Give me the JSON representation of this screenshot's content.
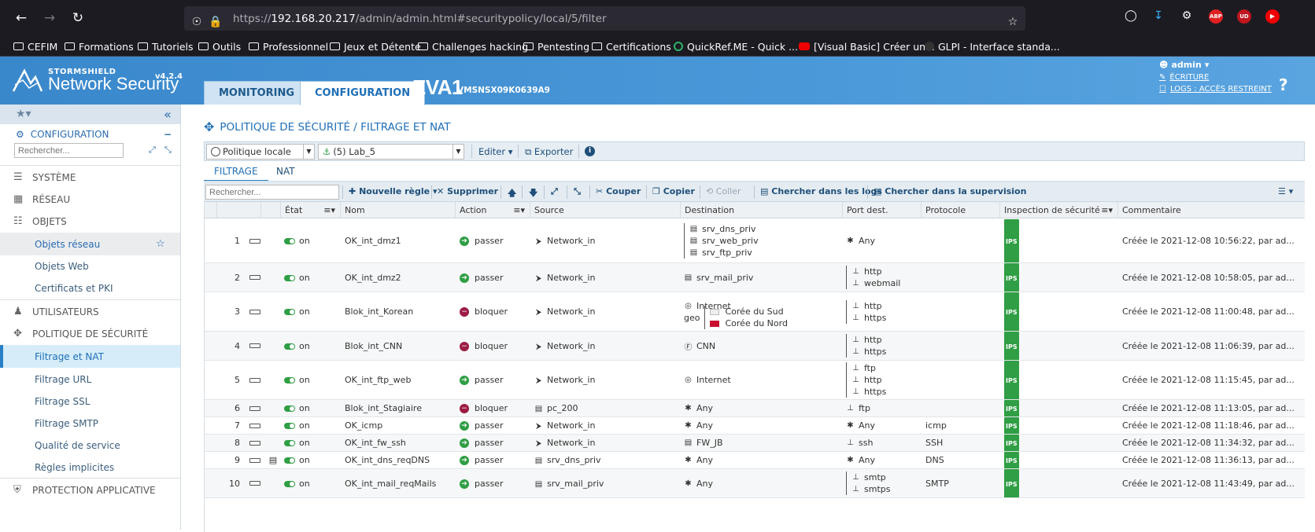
{
  "browser": {
    "url_base": "https://",
    "url_host": "192.168.20.217",
    "url_path": "/admin/admin.html#securitypolicy/local/5/filter",
    "bookmarks": [
      {
        "label": "CEFIM",
        "icon": "folder-icon"
      },
      {
        "label": "Formations",
        "icon": "folder-icon"
      },
      {
        "label": "Tutoriels",
        "icon": "folder-icon"
      },
      {
        "label": "Outils",
        "icon": "folder-icon"
      },
      {
        "label": "Professionnel",
        "icon": "folder-icon"
      },
      {
        "label": "Jeux et Détente",
        "icon": "folder-icon"
      },
      {
        "label": "Challenges hacking",
        "icon": "folder-icon"
      },
      {
        "label": "Pentesting",
        "icon": "folder-icon"
      },
      {
        "label": "Certifications",
        "icon": "folder-icon"
      },
      {
        "label": "QuickRef.ME - Quick ...",
        "icon": "quickref-icon"
      },
      {
        "label": "[Visual Basic] Créer un...",
        "icon": "youtube-icon"
      },
      {
        "label": "GLPI - Interface standa...",
        "icon": "glpi-icon"
      }
    ],
    "ext_badges": [
      "ABP",
      "UD"
    ]
  },
  "header": {
    "brand_top": "STORMSHIELD",
    "brand_main": "Network Security",
    "version": "v4.2.4",
    "tabs": [
      {
        "label": "MONITORING"
      },
      {
        "label": "CONFIGURATION"
      }
    ],
    "firewall_name": "EVA1",
    "serial": "VMSNSX09K0639A9",
    "user": "admin",
    "write_mode": "ÉCRITURE",
    "logs_access": "LOGS : ACCÈS RESTREINT",
    "help": "?"
  },
  "sidebar": {
    "section_title": "CONFIGURATION",
    "section_toggle": "−",
    "search_placeholder": "Rechercher...",
    "items": [
      {
        "label": "SYSTÈME"
      },
      {
        "label": "RÉSEAU"
      },
      {
        "label": "OBJETS"
      },
      {
        "label": "Objets réseau"
      },
      {
        "label": "Objets Web"
      },
      {
        "label": "Certificats et PKI"
      },
      {
        "label": "UTILISATEURS"
      },
      {
        "label": "POLITIQUE DE SÉCURITÉ"
      },
      {
        "label": "Filtrage et NAT"
      },
      {
        "label": "Filtrage URL"
      },
      {
        "label": "Filtrage SSL"
      },
      {
        "label": "Filtrage SMTP"
      },
      {
        "label": "Qualité de service"
      },
      {
        "label": "Règles implicites"
      },
      {
        "label": "PROTECTION APPLICATIVE"
      }
    ]
  },
  "main": {
    "title": "POLITIQUE DE SÉCURITÉ / FILTRAGE ET NAT",
    "policy_type": "Politique locale",
    "policy_slot": "(5) Lab_5",
    "edit_label": "Editer",
    "export_label": "Exporter",
    "tabs": [
      {
        "label": "FILTRAGE"
      },
      {
        "label": "NAT"
      }
    ],
    "toolbar": {
      "search_placeholder": "Rechercher...",
      "new_rule": "Nouvelle règle",
      "delete": "Supprimer",
      "cut": "Couper",
      "copy": "Copier",
      "paste": "Coller",
      "search_logs": "Chercher dans les logs",
      "search_supervision": "Chercher dans la supervision"
    },
    "columns": [
      "",
      "",
      "",
      "État",
      "Nom",
      "Action",
      "Source",
      "Destination",
      "Port dest.",
      "Protocole",
      "Inspection de sécurité",
      "Commentaire"
    ]
  },
  "rules": [
    {
      "num": "1",
      "state": "on",
      "name": "OK_int_dmz1",
      "action": "passer",
      "action_type": "pass",
      "source": "Network_in",
      "source_icon": "network-icon",
      "destination": [
        "srv_dns_priv",
        "srv_web_priv",
        "srv_ftp_priv"
      ],
      "dest_icon": "host-icon",
      "ports": [
        "Any"
      ],
      "port_icon": "any-icon",
      "protocol": "",
      "inspection": "IPS",
      "comment": "Créée le 2021-12-08 10:56:22, par ad..."
    },
    {
      "num": "2",
      "state": "on",
      "name": "OK_int_dmz2",
      "action": "passer",
      "action_type": "pass",
      "source": "Network_in",
      "source_icon": "network-icon",
      "destination": [
        "srv_mail_priv"
      ],
      "dest_icon": "host-icon",
      "ports": [
        "http",
        "webmail"
      ],
      "port_icon": "service-icon",
      "protocol": "",
      "inspection": "IPS",
      "comment": "Créée le 2021-12-08 10:58:05, par ad..."
    },
    {
      "num": "3",
      "state": "on",
      "name": "Blok_int_Korean",
      "action": "bloquer",
      "action_type": "block",
      "source": "Network_in",
      "source_icon": "network-icon",
      "destination": [
        "Internet"
      ],
      "dest_icon": "globe-icon",
      "geo_label": "geo",
      "geo": [
        "Corée du Sud",
        "Corée du Nord"
      ],
      "ports": [
        "http",
        "https"
      ],
      "port_icon": "service-icon",
      "protocol": "",
      "inspection": "IPS",
      "comment": "Créée le 2021-12-08 11:00:48, par ad..."
    },
    {
      "num": "4",
      "state": "on",
      "name": "Blok_int_CNN",
      "action": "bloquer",
      "action_type": "block",
      "source": "Network_in",
      "source_icon": "network-icon",
      "destination": [
        "CNN"
      ],
      "dest_icon": "fqdn-icon",
      "ports": [
        "http",
        "https"
      ],
      "port_icon": "service-icon",
      "protocol": "",
      "inspection": "IPS",
      "comment": "Créée le 2021-12-08 11:06:39, par ad..."
    },
    {
      "num": "5",
      "state": "on",
      "name": "OK_int_ftp_web",
      "action": "passer",
      "action_type": "pass",
      "source": "Network_in",
      "source_icon": "network-icon",
      "destination": [
        "Internet"
      ],
      "dest_icon": "globe-icon",
      "ports": [
        "ftp",
        "http",
        "https"
      ],
      "port_icon": "service-icon",
      "protocol": "",
      "inspection": "IPS",
      "comment": "Créée le 2021-12-08 11:15:45, par ad..."
    },
    {
      "num": "6",
      "state": "on",
      "name": "Blok_int_Stagiaire",
      "action": "bloquer",
      "action_type": "block",
      "source": "pc_200",
      "source_icon": "host-icon",
      "destination": [
        "Any"
      ],
      "dest_icon": "any-icon",
      "ports": [
        "ftp"
      ],
      "port_icon": "service-icon",
      "protocol": "",
      "inspection": "IPS",
      "comment": "Créée le 2021-12-08 11:13:05, par ad..."
    },
    {
      "num": "7",
      "state": "on",
      "name": "OK_icmp",
      "action": "passer",
      "action_type": "pass",
      "source": "Network_in",
      "source_icon": "network-icon",
      "destination": [
        "Any"
      ],
      "dest_icon": "any-icon",
      "ports": [
        "Any"
      ],
      "port_icon": "any-icon",
      "protocol": "icmp",
      "inspection": "IPS",
      "comment": "Créée le 2021-12-08 11:18:46, par ad..."
    },
    {
      "num": "8",
      "state": "on",
      "name": "OK_int_fw_ssh",
      "action": "passer",
      "action_type": "pass",
      "source": "Network_in",
      "source_icon": "network-icon",
      "destination": [
        "FW_JB"
      ],
      "dest_icon": "host-icon",
      "ports": [
        "ssh"
      ],
      "port_icon": "service-icon",
      "protocol": "SSH",
      "inspection": "IPS",
      "comment": "Créée le 2021-12-08 11:34:32, par ad..."
    },
    {
      "num": "9",
      "state": "on",
      "name": "OK_int_dns_reqDNS",
      "action": "passer",
      "action_type": "pass",
      "source": "srv_dns_priv",
      "source_icon": "host-icon",
      "destination": [
        "Any"
      ],
      "dest_icon": "any-icon",
      "ports": [
        "Any"
      ],
      "port_icon": "any-icon",
      "protocol": "DNS",
      "inspection": "IPS",
      "comment": "Créée le 2021-12-08 11:36:13, par ad...",
      "has_note": true
    },
    {
      "num": "10",
      "state": "on",
      "name": "OK_int_mail_reqMails",
      "action": "passer",
      "action_type": "pass",
      "source": "srv_mail_priv",
      "source_icon": "host-icon",
      "destination": [
        "Any"
      ],
      "dest_icon": "any-icon",
      "ports": [
        "smtp",
        "smtps"
      ],
      "port_icon": "service-icon",
      "protocol": "SMTP",
      "inspection": "IPS",
      "comment": "Créée le 2021-12-08 11:43:49, par ad..."
    }
  ]
}
